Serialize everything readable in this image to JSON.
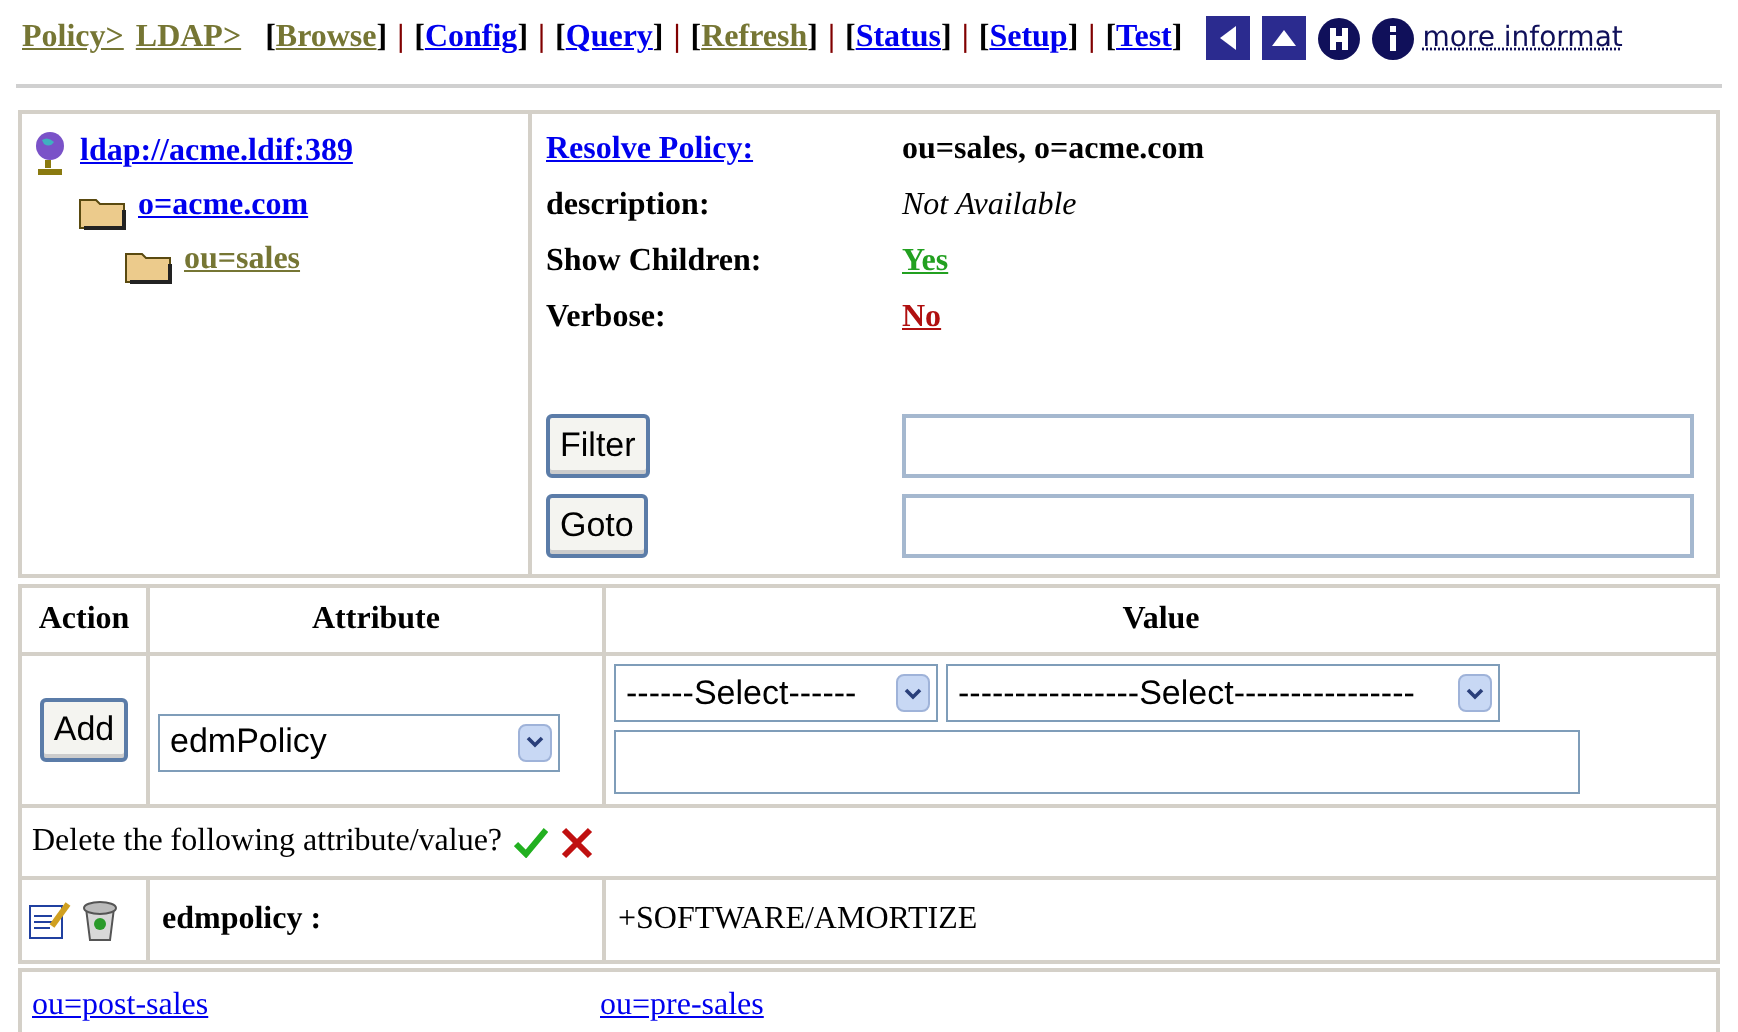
{
  "breadcrumb": [
    {
      "label": "Policy>",
      "visited": true
    },
    {
      "label": "LDAP>",
      "visited": true
    }
  ],
  "nav_links": [
    {
      "kind": "bracket",
      "text": "["
    },
    {
      "kind": "link",
      "label": "Browse",
      "visited": true
    },
    {
      "kind": "bracket",
      "text": "]"
    },
    {
      "kind": "separator",
      "text": "|"
    },
    {
      "kind": "bracket",
      "text": "["
    },
    {
      "kind": "link",
      "label": "Config",
      "visited": false
    },
    {
      "kind": "bracket",
      "text": "]"
    },
    {
      "kind": "separator",
      "text": "|"
    },
    {
      "kind": "bracket",
      "text": "["
    },
    {
      "kind": "link",
      "label": "Query",
      "visited": false
    },
    {
      "kind": "bracket",
      "text": "]"
    },
    {
      "kind": "separator",
      "text": "|"
    },
    {
      "kind": "bracket",
      "text": "["
    },
    {
      "kind": "link",
      "label": "Refresh",
      "visited": true
    },
    {
      "kind": "bracket",
      "text": "]"
    },
    {
      "kind": "separator",
      "text": "|"
    },
    {
      "kind": "bracket",
      "text": "["
    },
    {
      "kind": "link",
      "label": "Status",
      "visited": false
    },
    {
      "kind": "bracket",
      "text": "]"
    },
    {
      "kind": "separator",
      "text": "|"
    },
    {
      "kind": "bracket",
      "text": "["
    },
    {
      "kind": "link",
      "label": "Setup",
      "visited": false
    },
    {
      "kind": "bracket",
      "text": "]"
    },
    {
      "kind": "separator",
      "text": "|"
    },
    {
      "kind": "bracket",
      "text": "["
    },
    {
      "kind": "link",
      "label": "Test",
      "visited": false
    },
    {
      "kind": "bracket",
      "text": "]"
    }
  ],
  "more_info_link": "more informat",
  "tree": [
    {
      "label": "ldap://acme.ldif:389",
      "kind": "server",
      "visited": false,
      "children": [
        {
          "label": "o=acme.com",
          "kind": "folder",
          "visited": false,
          "children": [
            {
              "label": "ou=sales",
              "kind": "folder",
              "visited": true
            }
          ]
        }
      ]
    }
  ],
  "details": [
    {
      "label": {
        "text": "Resolve Policy:",
        "kind": "link"
      },
      "value": {
        "text": "ou=sales, o=acme.com",
        "kind": "bold"
      }
    },
    {
      "label": {
        "text": "description:",
        "kind": "bold"
      },
      "value": {
        "text": "Not Available",
        "kind": "italic"
      }
    },
    {
      "label": {
        "text": "Show Children:",
        "kind": "bold"
      },
      "value": {
        "text": "Yes",
        "kind": "yes"
      }
    },
    {
      "label": {
        "text": "Verbose:",
        "kind": "bold"
      },
      "value": {
        "text": "No",
        "kind": "no"
      }
    }
  ],
  "filter_button": "Filter",
  "goto_button": "Goto",
  "attribute_table": {
    "columns": [
      "Action",
      "Attribute",
      "Value"
    ],
    "add_button": "Add",
    "attribute_select": "edmPolicy",
    "value_select_1": "------Select------",
    "value_select_2": "----------------Select----------------",
    "delete_prompt": "Delete the following attribute/value?",
    "rows": [
      {
        "attribute": "edmpolicy :",
        "value": "+SOFTWARE/AMORTIZE"
      }
    ]
  },
  "child_links": [
    {
      "label": "ou=post-sales"
    },
    {
      "label": "ou=pre-sales"
    }
  ]
}
